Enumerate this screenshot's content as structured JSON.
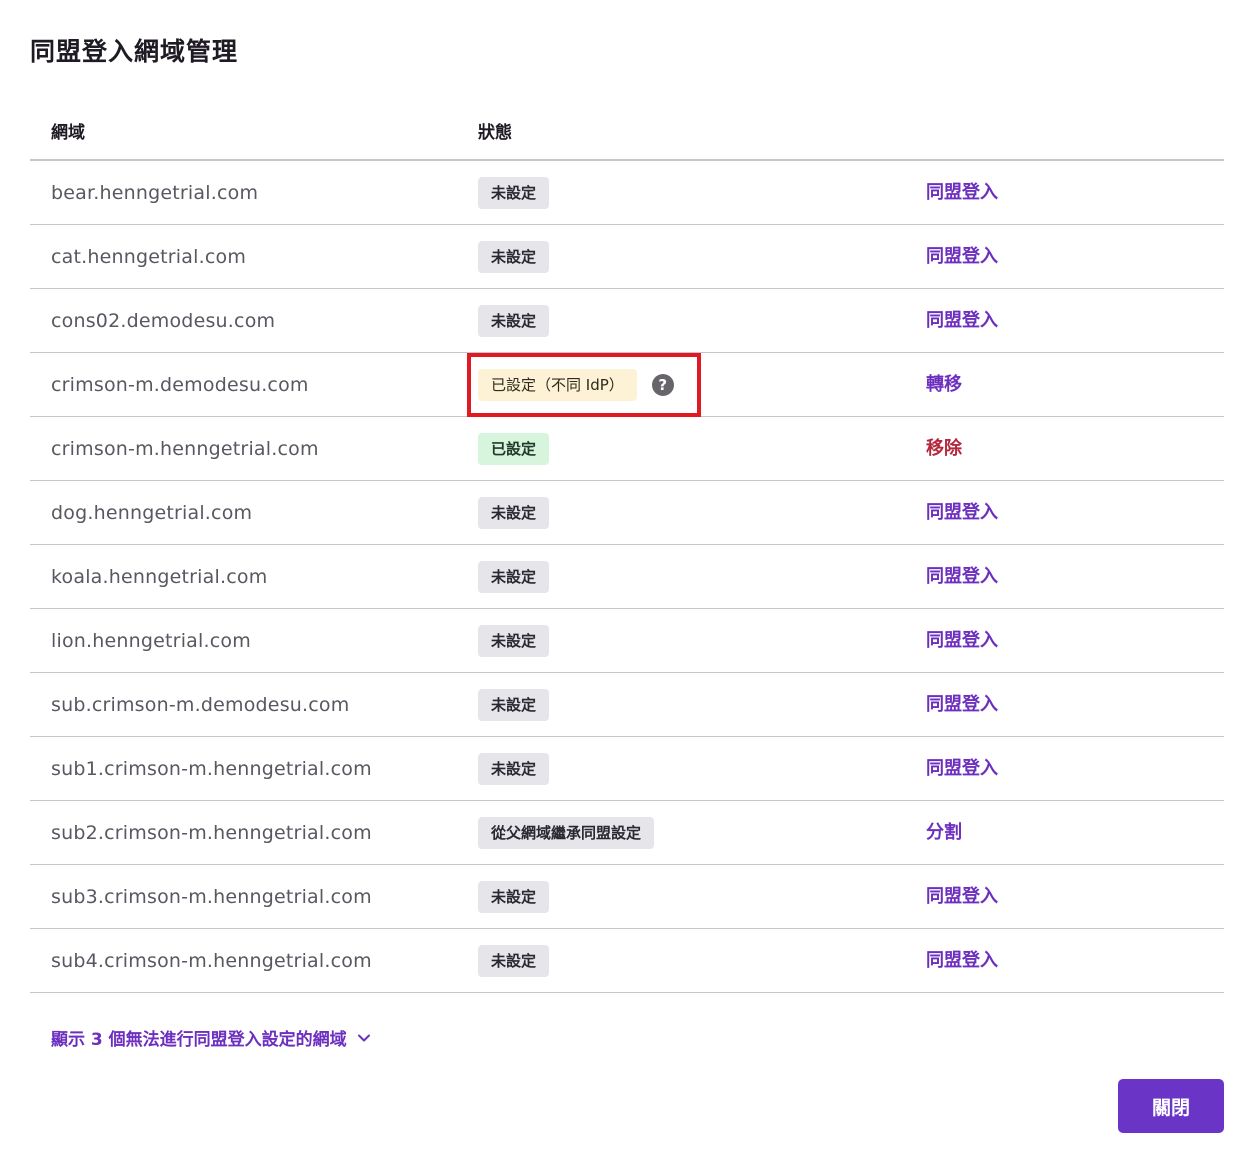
{
  "dialog": {
    "title": "同盟登入網域管理",
    "close_label": "關閉",
    "expand_label": "顯示 3 個無法進行同盟登入設定的網域"
  },
  "table": {
    "headers": {
      "domain": "網域",
      "status": "狀態"
    },
    "rows": [
      {
        "domain": "bear.henngetrial.com",
        "status": "未設定",
        "status_type": "neutral",
        "action": "同盟登入",
        "action_type": "primary"
      },
      {
        "domain": "cat.henngetrial.com",
        "status": "未設定",
        "status_type": "neutral",
        "action": "同盟登入",
        "action_type": "primary"
      },
      {
        "domain": "cons02.demodesu.com",
        "status": "未設定",
        "status_type": "neutral",
        "action": "同盟登入",
        "action_type": "primary"
      },
      {
        "domain": "crimson-m.demodesu.com",
        "status": "已設定（不同 IdP）",
        "status_type": "warning",
        "has_help": true,
        "highlighted": true,
        "action": "轉移",
        "action_type": "primary"
      },
      {
        "domain": "crimson-m.henngetrial.com",
        "status": "已設定",
        "status_type": "success",
        "action": "移除",
        "action_type": "danger"
      },
      {
        "domain": "dog.henngetrial.com",
        "status": "未設定",
        "status_type": "neutral",
        "action": "同盟登入",
        "action_type": "primary"
      },
      {
        "domain": "koala.henngetrial.com",
        "status": "未設定",
        "status_type": "neutral",
        "action": "同盟登入",
        "action_type": "primary"
      },
      {
        "domain": "lion.henngetrial.com",
        "status": "未設定",
        "status_type": "neutral",
        "action": "同盟登入",
        "action_type": "primary"
      },
      {
        "domain": "sub.crimson-m.demodesu.com",
        "status": "未設定",
        "status_type": "neutral",
        "action": "同盟登入",
        "action_type": "primary"
      },
      {
        "domain": "sub1.crimson-m.henngetrial.com",
        "status": "未設定",
        "status_type": "neutral",
        "action": "同盟登入",
        "action_type": "primary"
      },
      {
        "domain": "sub2.crimson-m.henngetrial.com",
        "status": "從父網域繼承同盟設定",
        "status_type": "neutral",
        "action": "分割",
        "action_type": "primary"
      },
      {
        "domain": "sub3.crimson-m.henngetrial.com",
        "status": "未設定",
        "status_type": "neutral",
        "action": "同盟登入",
        "action_type": "primary"
      },
      {
        "domain": "sub4.crimson-m.henngetrial.com",
        "status": "未設定",
        "status_type": "neutral",
        "action": "同盟登入",
        "action_type": "primary"
      }
    ]
  },
  "icons": {
    "help": "question-circle-icon",
    "expand": "chevron-down-icon"
  },
  "colors": {
    "accent": "#6a35c7",
    "danger": "#b3283d",
    "highlight_border": "#e01a22",
    "badge_neutral": "#e6e5ea",
    "badge_success": "#d7f4dc",
    "badge_warning": "#fdf1d6"
  }
}
